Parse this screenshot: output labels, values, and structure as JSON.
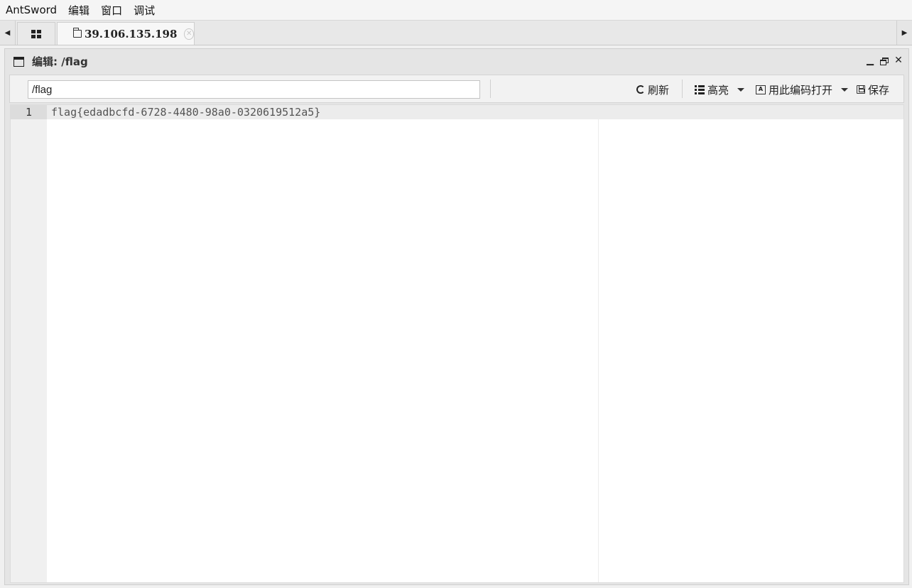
{
  "menubar": {
    "items": [
      "AntSword",
      "编辑",
      "窗口",
      "调试"
    ]
  },
  "tabs": {
    "host_label": "39.106.135.198",
    "close_glyph": "✕"
  },
  "panel": {
    "title": "编辑: /flag"
  },
  "toolbar": {
    "path_value": "/flag",
    "refresh_label": "刷新",
    "highlight_label": "高亮",
    "open_encoding_label": "用此编码打开",
    "save_label": "保存"
  },
  "editor": {
    "lines": [
      {
        "number": "1",
        "text": "flag{edadbcfd-6728-4480-98a0-0320619512a5}"
      }
    ]
  },
  "icons": {
    "grid": "grid-icon",
    "folder": "folder-icon",
    "window": "window-icon",
    "refresh": "refresh-icon",
    "list": "list-icon",
    "encode": "encode-icon",
    "save": "save-icon"
  }
}
